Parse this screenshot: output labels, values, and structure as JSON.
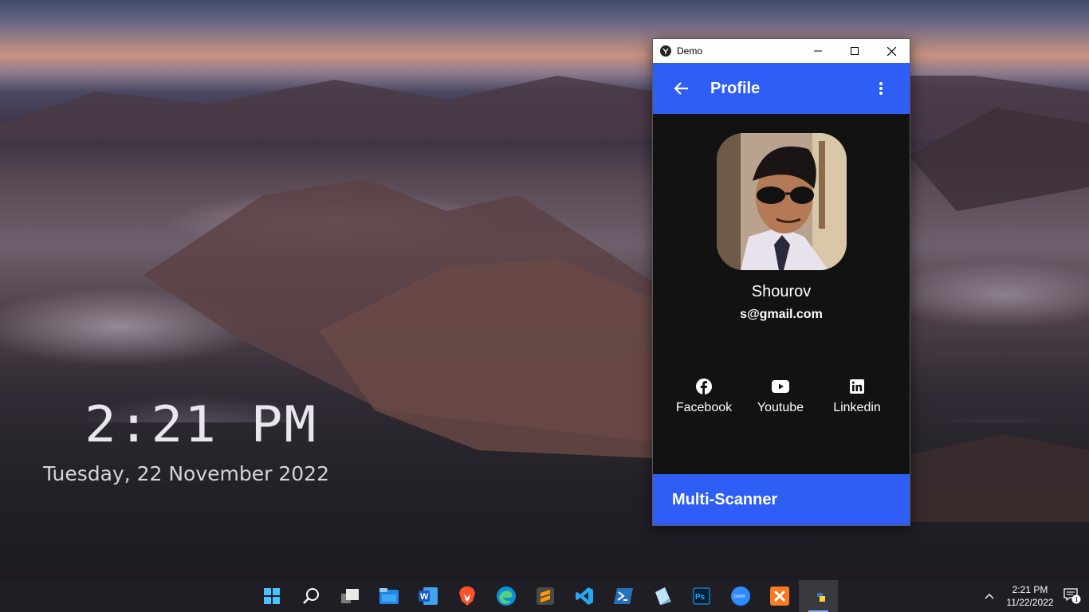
{
  "desktop": {
    "time": "2:21 PM",
    "date": "Tuesday, 22 November 2022"
  },
  "window": {
    "title": "Demo",
    "controls": [
      "minimize-icon",
      "maximize-icon",
      "close-icon"
    ],
    "appbar": {
      "title": "Profile",
      "back_icon": "arrow-left-icon",
      "menu_icon": "more-vert-icon",
      "color": "#2e5ef5"
    },
    "profile": {
      "name": "Shourov",
      "email": "s@gmail.com"
    },
    "social": [
      {
        "label": "Facebook",
        "icon": "facebook-icon"
      },
      {
        "label": "Youtube",
        "icon": "youtube-icon"
      },
      {
        "label": "Linkedin",
        "icon": "linkedin-icon"
      }
    ],
    "footer": {
      "label": "Multi-Scanner"
    }
  },
  "taskbar": {
    "apps": [
      "windows-start-icon",
      "search-icon",
      "task-view-icon",
      "file-explorer-icon",
      "word-icon",
      "brave-icon",
      "edge-icon",
      "sublime-text-icon",
      "vscode-icon",
      "powershell-icon",
      "app-icon",
      "photoshop-icon",
      "zoom-icon",
      "xampp-icon",
      "python-icon"
    ],
    "tray": {
      "time": "2:21 PM",
      "date": "11/22/2022",
      "notifications": "1"
    }
  }
}
